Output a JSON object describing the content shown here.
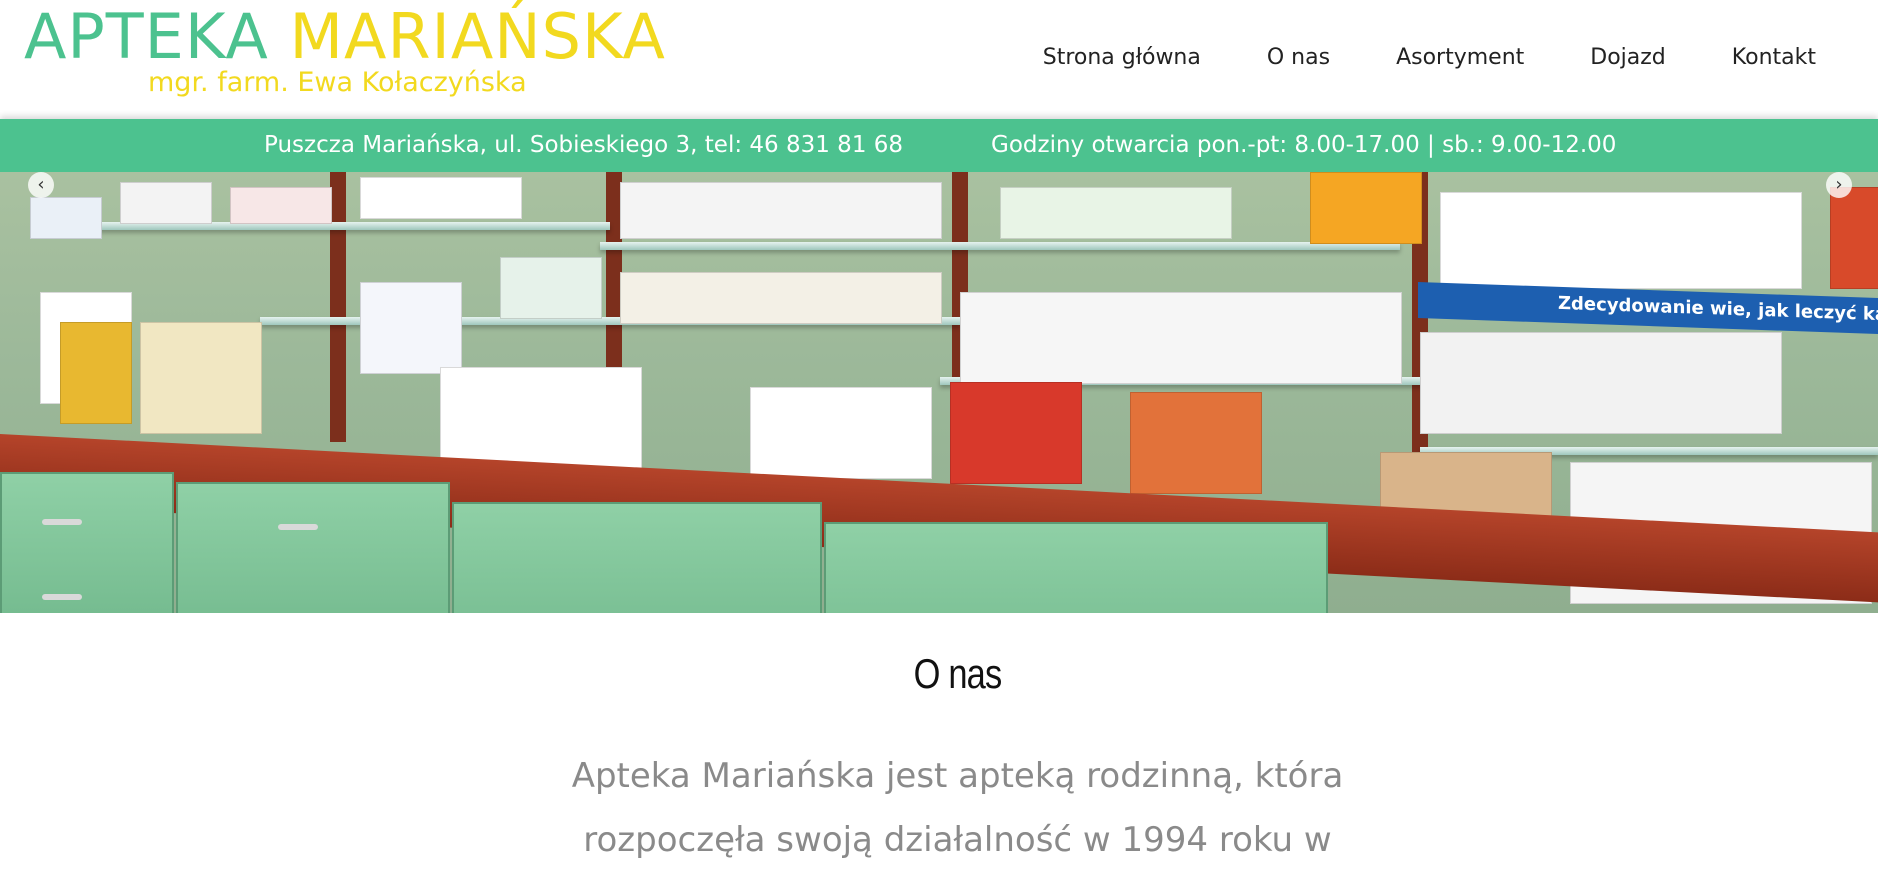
{
  "logo": {
    "title_part1": "APTEKA",
    "title_part2": "MARIAŃSKA",
    "subtitle": "mgr. farm. Ewa Kołaczyńska"
  },
  "nav": {
    "items": [
      "Strona główna",
      "O nas",
      "Asortyment",
      "Dojazd",
      "Kontakt"
    ]
  },
  "infobar": {
    "address": "Puszcza Mariańska, ul. Sobieskiego 3, tel: 46 831 81 68",
    "hours": "Godziny otwarcia pon.-pt: 8.00-17.00 | sb.: 9.00-12.00"
  },
  "slider": {
    "image_banner_text": "Zdecydowanie wie, jak leczyć kaszel.",
    "prev_icon": "chevron-left-icon",
    "next_icon": "chevron-right-icon",
    "prev_glyph": "‹",
    "next_glyph": "›"
  },
  "about": {
    "title": "O nas",
    "text": "Apteka Mariańska jest apteką rodzinną, która rozpoczęła swoją działalność w 1994 roku w"
  },
  "colors": {
    "green": "#4cc28f",
    "yellow": "#f2d91f",
    "text_gray": "#8a8a8a"
  }
}
